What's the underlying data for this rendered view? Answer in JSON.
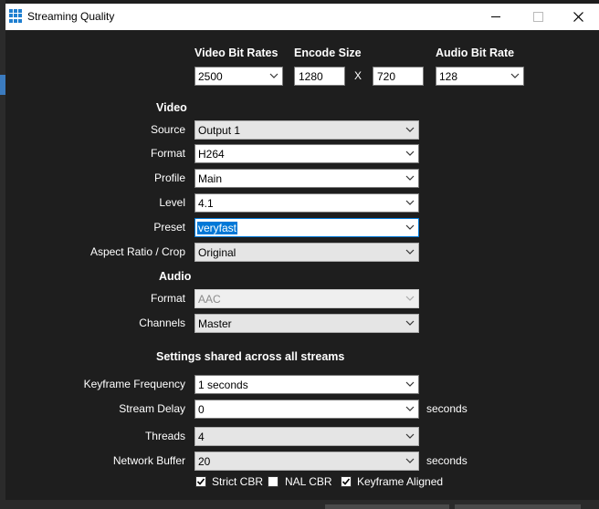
{
  "window": {
    "title": "Streaming Quality"
  },
  "header": {
    "video_bit_rates_label": "Video Bit Rates",
    "encode_size_label": "Encode Size",
    "audio_bit_rate_label": "Audio Bit Rate",
    "video_bit_rate_value": "2500",
    "encode_width": "1280",
    "encode_x": "X",
    "encode_height": "720",
    "audio_bit_rate_value": "128"
  },
  "video": {
    "section_label": "Video",
    "source": {
      "label": "Source",
      "value": "Output 1"
    },
    "format": {
      "label": "Format",
      "value": "H264"
    },
    "profile": {
      "label": "Profile",
      "value": "Main"
    },
    "level": {
      "label": "Level",
      "value": "4.1"
    },
    "preset": {
      "label": "Preset",
      "value": "veryfast"
    },
    "aspect": {
      "label": "Aspect Ratio / Crop",
      "value": "Original"
    }
  },
  "audio": {
    "section_label": "Audio",
    "format": {
      "label": "Format",
      "value": "AAC"
    },
    "channels": {
      "label": "Channels",
      "value": "Master"
    }
  },
  "shared": {
    "section_label": "Settings shared across all streams",
    "keyframe": {
      "label": "Keyframe Frequency",
      "value": "1 seconds"
    },
    "stream_delay": {
      "label": "Stream Delay",
      "value": "0",
      "unit": "seconds"
    },
    "threads": {
      "label": "Threads",
      "value": "4"
    },
    "network_buffer": {
      "label": "Network Buffer",
      "value": "20",
      "unit": "seconds"
    },
    "checkboxes": [
      {
        "label": "Strict CBR",
        "checked": true
      },
      {
        "label": "NAL CBR",
        "checked": false
      },
      {
        "label": "Keyframe Aligned",
        "checked": true
      }
    ]
  },
  "icons": {
    "app": "grid-app-icon",
    "dropdown": "chevron-down-icon",
    "check": "checkmark-icon"
  },
  "colors": {
    "background": "#1e1e1e",
    "focus": "#0078d7",
    "titlebar": "#ffffff"
  }
}
